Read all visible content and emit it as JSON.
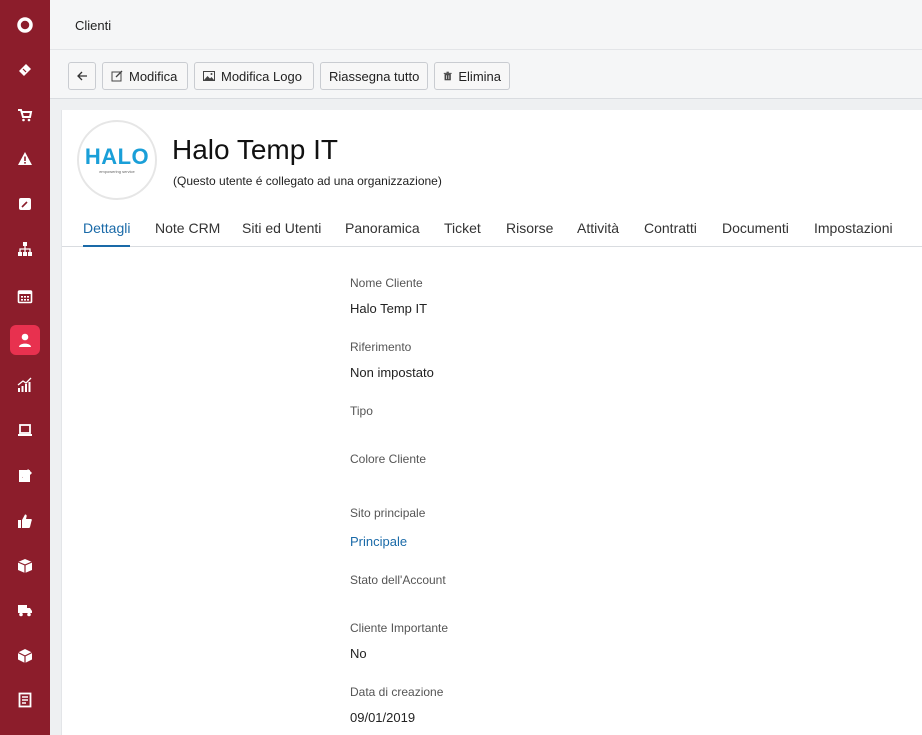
{
  "header": {
    "title": "Clienti"
  },
  "sidebar": {
    "items": [
      {
        "icon": "circle-logo-icon"
      },
      {
        "icon": "ticket-icon"
      },
      {
        "icon": "cart-icon"
      },
      {
        "icon": "warning-icon"
      },
      {
        "icon": "edit-note-icon"
      },
      {
        "icon": "org-chart-icon"
      },
      {
        "icon": "calendar-icon"
      },
      {
        "icon": "user-icon",
        "active": true
      },
      {
        "icon": "chart-icon"
      },
      {
        "icon": "laptop-icon"
      },
      {
        "icon": "document-edit-icon"
      },
      {
        "icon": "thumbs-up-icon"
      },
      {
        "icon": "box-icon"
      },
      {
        "icon": "truck-icon"
      },
      {
        "icon": "package-icon"
      },
      {
        "icon": "report-icon"
      }
    ]
  },
  "toolbar": {
    "back_icon": "arrow-left-icon",
    "edit_label": "Modifica",
    "edit_logo_label": "Modifica Logo",
    "reassign_label": "Riassegna tutto",
    "delete_label": "Elimina"
  },
  "client": {
    "logo_text": "HALO",
    "logo_tagline": "empowering service",
    "name": "Halo Temp IT",
    "subtitle": "(Questo utente é collegato ad una organizzazione)"
  },
  "tabs": [
    {
      "label": "Dettagli",
      "active": true
    },
    {
      "label": "Note CRM"
    },
    {
      "label": "Siti ed Utenti"
    },
    {
      "label": "Panoramica"
    },
    {
      "label": "Ticket"
    },
    {
      "label": "Risorse"
    },
    {
      "label": "Attività"
    },
    {
      "label": "Contratti"
    },
    {
      "label": "Documenti"
    },
    {
      "label": "Impostazioni"
    }
  ],
  "details": {
    "nome_cliente_label": "Nome Cliente",
    "nome_cliente_value": "Halo Temp IT",
    "riferimento_label": "Riferimento",
    "riferimento_value": "Non impostato",
    "tipo_label": "Tipo",
    "colore_label": "Colore Cliente",
    "sito_label": "Sito principale",
    "sito_value": "Principale",
    "stato_label": "Stato dell'Account",
    "importante_label": "Cliente Importante",
    "importante_value": "No",
    "data_label": "Data di creazione",
    "data_value": "09/01/2019"
  },
  "colors": {
    "sidebar": "#8c1d2b",
    "sidebar_active": "#e8314f",
    "accent": "#1a6aa8",
    "logo_blue": "#1a9fd8"
  }
}
